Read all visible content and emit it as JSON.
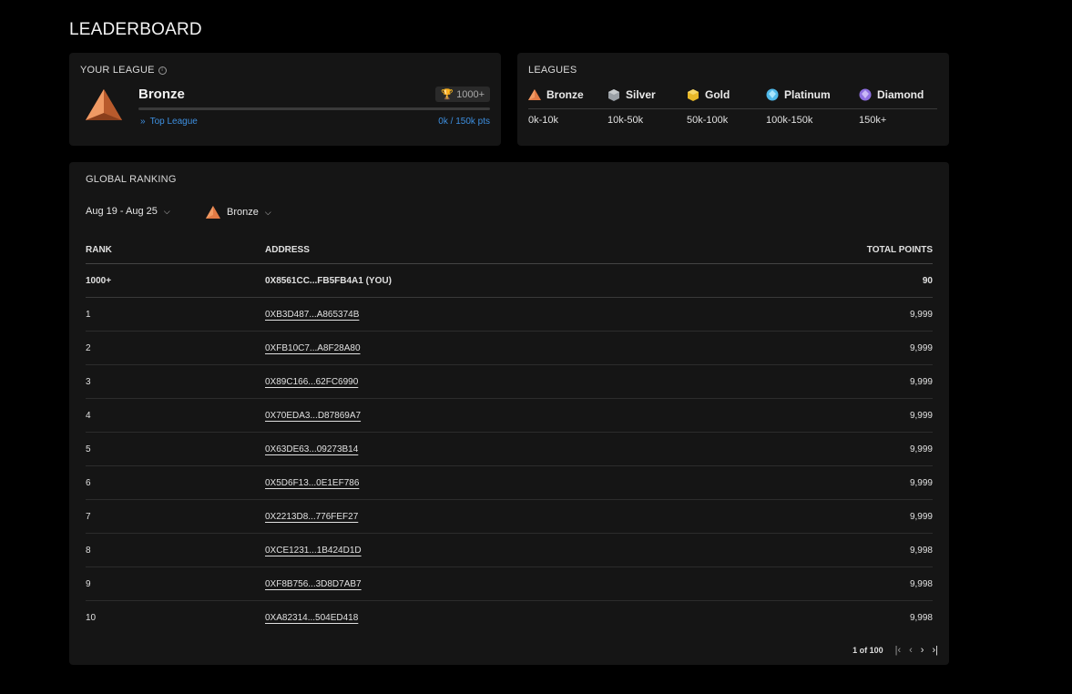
{
  "page": {
    "title": "LEADERBOARD"
  },
  "your_league": {
    "label": "YOUR LEAGUE",
    "league_name": "Bronze",
    "rank_badge": "1000+",
    "progress_fraction": 0.0,
    "top_league_link": "Top League",
    "points_progress": "0k / 150k pts"
  },
  "leagues": {
    "label": "LEAGUES",
    "items": [
      {
        "name": "Bronze",
        "range": "0k-10k",
        "icon": "bronze-league-icon",
        "color": "#e07a45"
      },
      {
        "name": "Silver",
        "range": "10k-50k",
        "icon": "silver-league-icon",
        "color": "#9aa0a6"
      },
      {
        "name": "Gold",
        "range": "50k-100k",
        "icon": "gold-league-icon",
        "color": "#e8b828"
      },
      {
        "name": "Platinum",
        "range": "100k-150k",
        "icon": "platinum-league-icon",
        "color": "#4fb8e8"
      },
      {
        "name": "Diamond",
        "range": "150k+",
        "icon": "diamond-league-icon",
        "color": "#8e6fe0"
      }
    ]
  },
  "ranking": {
    "label": "GLOBAL RANKING",
    "date_filter": "Aug 19 - Aug 25",
    "league_filter": "Bronze",
    "columns": {
      "rank": "RANK",
      "address": "ADDRESS",
      "points": "TOTAL POINTS"
    },
    "you_row": {
      "rank": "1000+",
      "address": "0X8561CC...FB5FB4A1 (YOU)",
      "points": "90"
    },
    "rows": [
      {
        "rank": "1",
        "address": "0XB3D487...A865374B",
        "points": "9,999"
      },
      {
        "rank": "2",
        "address": "0XFB10C7...A8F28A80",
        "points": "9,999"
      },
      {
        "rank": "3",
        "address": "0X89C166...62FC6990",
        "points": "9,999"
      },
      {
        "rank": "4",
        "address": "0X70EDA3...D87869A7",
        "points": "9,999"
      },
      {
        "rank": "5",
        "address": "0X63DE63...09273B14",
        "points": "9,999"
      },
      {
        "rank": "6",
        "address": "0X5D6F13...0E1EF786",
        "points": "9,999"
      },
      {
        "rank": "7",
        "address": "0X2213D8...776FEF27",
        "points": "9,999"
      },
      {
        "rank": "8",
        "address": "0XCE1231...1B424D1D",
        "points": "9,998"
      },
      {
        "rank": "9",
        "address": "0XF8B756...3D8D7AB7",
        "points": "9,998"
      },
      {
        "rank": "10",
        "address": "0XA82314...504ED418",
        "points": "9,998"
      }
    ],
    "pagination": {
      "text": "1 of 100"
    }
  }
}
